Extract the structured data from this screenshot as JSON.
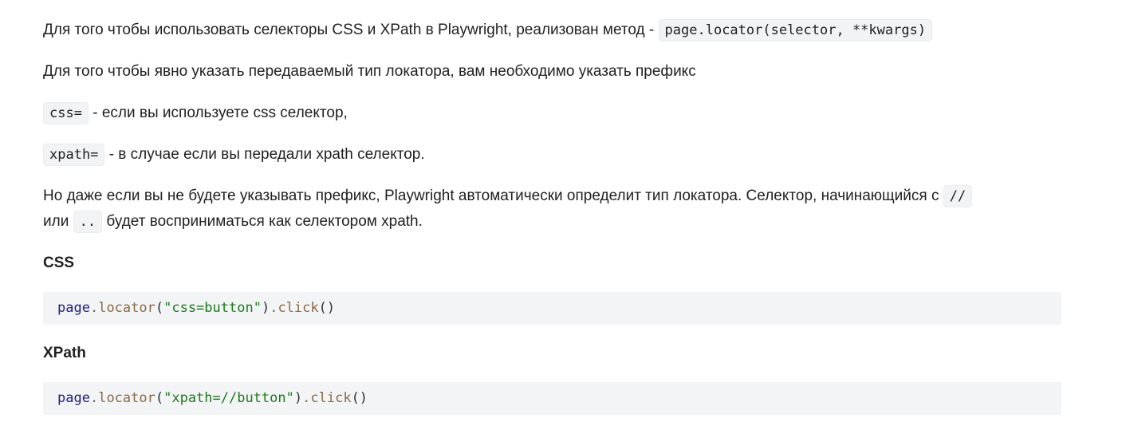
{
  "para1": {
    "text": "Для того чтобы использовать селекторы  CSS и XPath в Playwright, реализован метод - ",
    "code": "page.locator(selector, **kwargs)"
  },
  "para2": {
    "text": "Для того чтобы явно указать передаваемый тип локатора, вам необходимо указать префикс"
  },
  "para3": {
    "code": "css=",
    "text": " - если вы используете css селектор,"
  },
  "para4": {
    "code": "xpath=",
    "text": " -  в случае если вы передали xpath селектор."
  },
  "para5": {
    "line1_text": "Но даже если вы не будете указывать префикс,  Playwright автоматически определит тип локатора. Селектор, начинающийся с ",
    "line1_code": "//",
    "line2_prefix": "или ",
    "line2_code": "..",
    "line2_text": " будет восприниматься как селектором xpath."
  },
  "section_css": {
    "heading": "CSS",
    "code": {
      "obj": "page",
      "dot1": ".",
      "method1": "locator",
      "open": "(",
      "arg": "\"css=button\"",
      "close": ")",
      "dot2": ".",
      "method2": "click",
      "call": "()"
    }
  },
  "section_xpath": {
    "heading": "XPath",
    "code": {
      "obj": "page",
      "dot1": ".",
      "method1": "locator",
      "open": "(",
      "arg": "\"xpath=//button\"",
      "close": ")",
      "dot2": ".",
      "method2": "click",
      "call": "()"
    }
  },
  "colors": {
    "code_bg": "#f3f4f6",
    "variable": "#1c2080",
    "method": "#8a6a45",
    "string": "#1c7a1c"
  }
}
